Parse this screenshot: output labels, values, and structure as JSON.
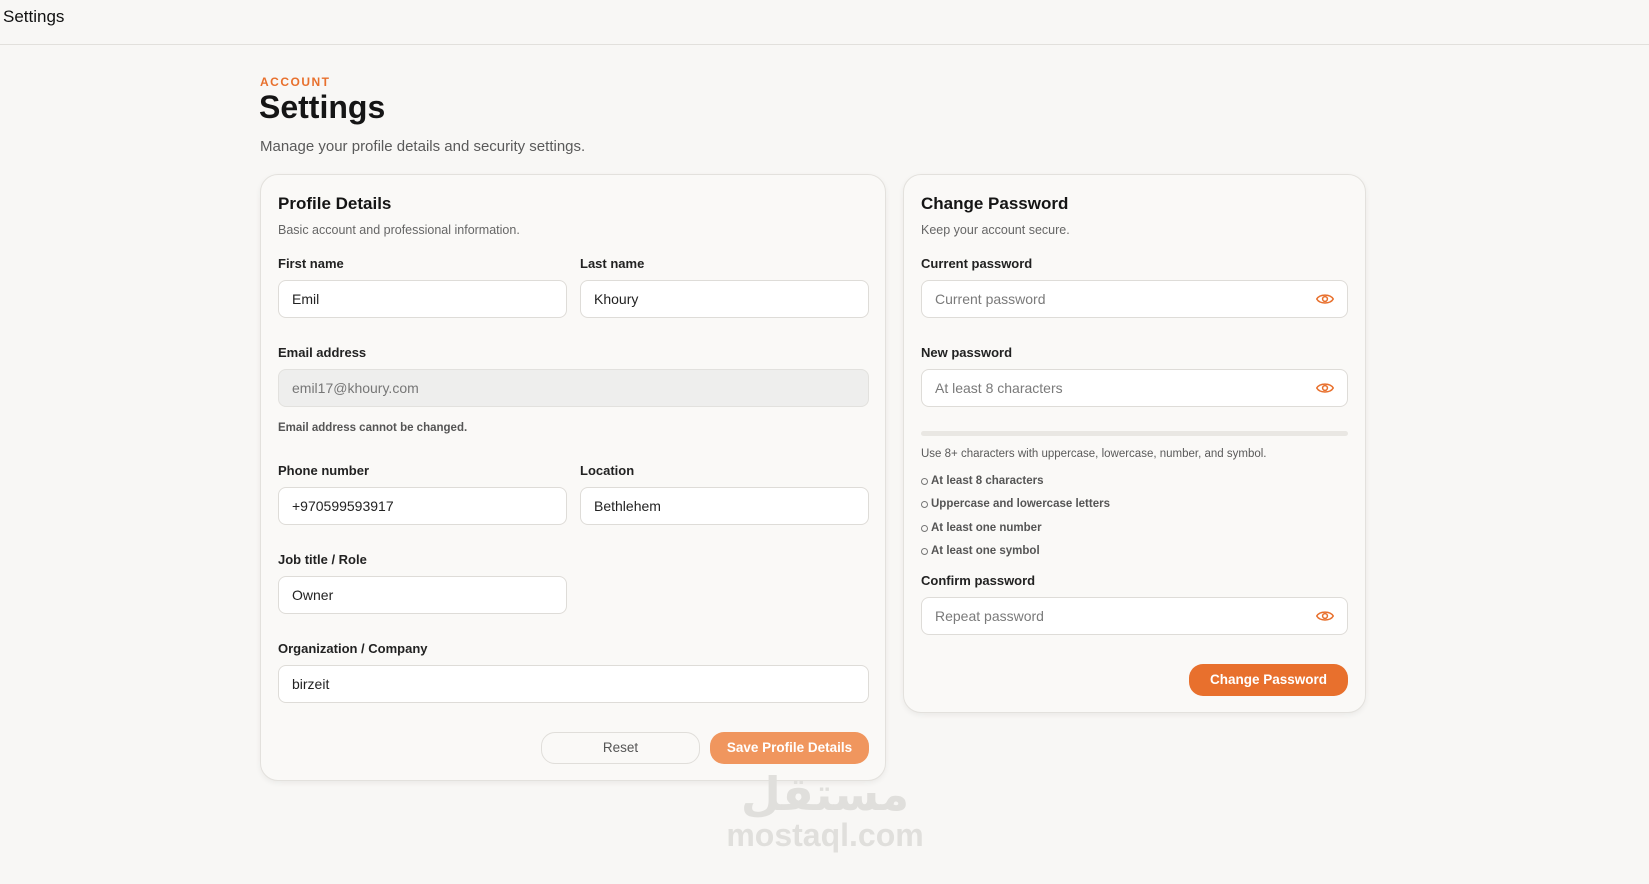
{
  "topbar": {
    "title": "Settings"
  },
  "header": {
    "eyebrow": "ACCOUNT",
    "title": "Settings",
    "subtitle": "Manage your profile details and security settings."
  },
  "profile": {
    "title": "Profile Details",
    "subtitle": "Basic account and professional information.",
    "first_name": {
      "label": "First name",
      "value": "Emil"
    },
    "last_name": {
      "label": "Last name",
      "value": "Khoury"
    },
    "email": {
      "label": "Email address",
      "value": "emil17@khoury.com",
      "hint": "Email address cannot be changed."
    },
    "phone": {
      "label": "Phone number",
      "value": "+970599593917"
    },
    "location": {
      "label": "Location",
      "value": "Bethlehem"
    },
    "job_title": {
      "label": "Job title / Role",
      "value": "Owner"
    },
    "organization": {
      "label": "Organization / Company",
      "value": "birzeit"
    },
    "reset_label": "Reset",
    "save_label": "Save Profile Details"
  },
  "password": {
    "title": "Change Password",
    "subtitle": "Keep your account secure.",
    "current": {
      "label": "Current password",
      "placeholder": "Current password"
    },
    "new": {
      "label": "New password",
      "placeholder": "At least 8 characters"
    },
    "strength_hint": "Use 8+ characters with uppercase, lowercase, number, and symbol.",
    "requirements": [
      "At least 8 characters",
      "Uppercase and lowercase letters",
      "At least one number",
      "At least one symbol"
    ],
    "confirm": {
      "label": "Confirm password",
      "placeholder": "Repeat password"
    },
    "submit_label": "Change Password"
  },
  "watermark": {
    "arabic": "مستقل",
    "latin": "mostaql.com"
  },
  "colors": {
    "accent": "#e8702d",
    "accent_light": "#f0965e",
    "background": "#f8f7f5"
  },
  "icons": {
    "password_toggle": "eye-icon"
  }
}
